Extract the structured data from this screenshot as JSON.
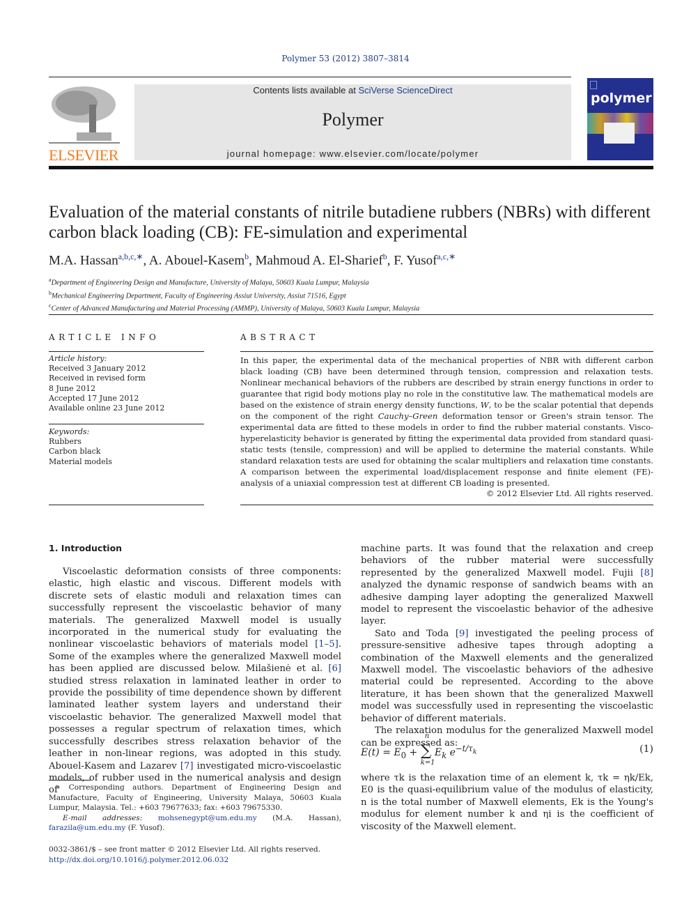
{
  "header": {
    "citation": "Polymer 53 (2012) 3807–3814",
    "contents_prefix": "Contents lists available at ",
    "contents_link": "SciVerse ScienceDirect",
    "journal_name": "Polymer",
    "homepage": "journal homepage: www.elsevier.com/locate/polymer",
    "publisher_logo_text": "ELSEVIER",
    "cover_title": "polymer",
    "colors": {
      "elsevier_orange": "#f47b20",
      "cover_blue": "#24308f",
      "link_blue": "#1f3c88",
      "banner_gray": "#e6e6e6"
    }
  },
  "article": {
    "title": "Evaluation of the material constants of nitrile butadiene rubbers (NBRs) with different carbon black loading (CB): FE-simulation and experimental",
    "authors": [
      {
        "name": "M.A. Hassan",
        "sup": "a,b,c,∗",
        "sep": ", "
      },
      {
        "name": "A. Abouel-Kasem",
        "sup": "b",
        "sep": ", "
      },
      {
        "name": "Mahmoud A. El-Sharief",
        "sup": "b",
        "sep": ", "
      },
      {
        "name": "F. Yusof",
        "sup": "a,c,∗",
        "sep": ""
      }
    ],
    "affiliations": [
      {
        "key": "a",
        "text": "Department of Engineering Design and Manufacture, University of Malaya, 50603 Kuala Lumpur, Malaysia"
      },
      {
        "key": "b",
        "text": "Mechanical Engineering Department, Faculty of Engineering Assiut University, Assiut 71516, Egypt"
      },
      {
        "key": "c",
        "text": "Center of Advanced Manufacturing and Material Processing (AMMP), University of Malaya, 50603 Kuala Lumpur, Malaysia"
      }
    ]
  },
  "article_info": {
    "heading": "ARTICLE INFO",
    "history_label": "Article history:",
    "history": [
      "Received 3 January 2012",
      "Received in revised form",
      "8 June 2012",
      "Accepted 17 June 2012",
      "Available online 23 June 2012"
    ],
    "keywords_label": "Keywords:",
    "keywords": [
      "Rubbers",
      "Carbon black",
      "Material models"
    ]
  },
  "abstract": {
    "heading": "ABSTRACT",
    "p1": "In this paper, the experimental data of the mechanical properties of NBR with different carbon black loading (CB) have been determined through tension, compression and relaxation tests. Nonlinear mechanical behaviors of the rubbers are described by strain energy functions in order to guarantee that rigid body motions play no role in the constitutive law. The mathematical models are based on the existence of strain energy density functions, ",
    "w": "W",
    "p2": ", to be the scalar potential that depends on the component of the right ",
    "cauchy": "Cauchy–Green",
    "p3": " deformation tensor or Green's strain tensor. The experimental data are fitted to these models in order to find the rubber material constants. Visco-hyperelasticity behavior is generated by fitting the experimental data provided from standard quasi-static tests (tensile, compression) and will be applied to determine the material constants. While standard relaxation tests are used for obtaining the scalar multipliers and relaxation time constants. A comparison between the experimental load/displacement response and finite element (FE)-analysis of a uniaxial compression test at different CB loading is presented.",
    "copyright": "© 2012 Elsevier Ltd. All rights reserved."
  },
  "intro": {
    "heading": "1.  Introduction",
    "left_p1a": "Viscoelastic deformation consists of three components: elastic, high elastic and viscous. Different models with discrete sets of elastic moduli and relaxation times can successfully represent the viscoelastic behavior of many materials. The generalized Maxwell model is usually incorporated in the numerical study for evaluating the nonlinear viscoelastic behaviors of materials model ",
    "ref_1_5": "[1–5]",
    "left_p1b": ". Some of the examples where the generalized Maxwell model has been applied are discussed below. Milašienė et al. ",
    "ref_6": "[6]",
    "left_p1c": " studied stress relaxation in laminated leather in order to provide the possibility of time dependence shown by different laminated leather system layers and understand their viscoelastic behavior. The generalized Maxwell model that possesses a regular spectrum of relaxation times, which successfully describes stress relaxation behavior of the leather in non-linear regions, was adopted in this study. Abouel-Kasem and Lazarev ",
    "ref_7": "[7]",
    "left_p1d": " investigated micro-viscoelastic models, of rubber used in the numerical analysis and design of",
    "right_p1a": "machine parts. It was found that the relaxation and creep behaviors of the rubber material were successfully represented by the generalized Maxwell model. Fujii ",
    "ref_8": "[8]",
    "right_p1b": " analyzed the dynamic response of sandwich beams with an adhesive damping layer adopting the generalized Maxwell model to represent the viscoelastic behavior of the adhesive layer.",
    "right_p2a": "Sato and Toda ",
    "ref_9": "[9]",
    "right_p2b": " investigated the peeling process of pressure-sensitive adhesive tapes through adopting a combination of the Maxwell elements and the generalized Maxwell model. The viscoelastic behaviors of the adhesive material could be represented. According to the above literature, it has been shown that the generalized Maxwell model was successfully used in representing the viscoelastic behavior of different materials.",
    "right_p3": "The relaxation modulus for the generalized Maxwell model can be expressed as:",
    "equation_number": "(1)",
    "after_eq": "where τk is the relaxation time of an element k, τk = ηk/Ek, E0 is the quasi-equilibrium value of the modulus of elasticity, n is the total number of Maxwell elements, Ek is the Young's modulus for element number k and ηi is the coefficient of viscosity of the Maxwell element."
  },
  "footnotes": {
    "corresponding": "∗ Corresponding authors. Department of Engineering Design and Manufacture, Faculty of Engineering, University Malaya, 50603 Kuala Lumpur, Malaysia. Tel.: +603 79677633; fax: +603 79675330.",
    "email_label": "E-mail addresses:",
    "email1": "mohsenegypt@um.edu.my",
    "email1_owner": " (M.A. Hassan), ",
    "email2": "farazila@um.edu.my",
    "email2_owner": "(F. Yusof).",
    "issn": "0032-3861/$ – see front matter © 2012 Elsevier Ltd. All rights reserved.",
    "doi": "http://dx.doi.org/10.1016/j.polymer.2012.06.032"
  }
}
